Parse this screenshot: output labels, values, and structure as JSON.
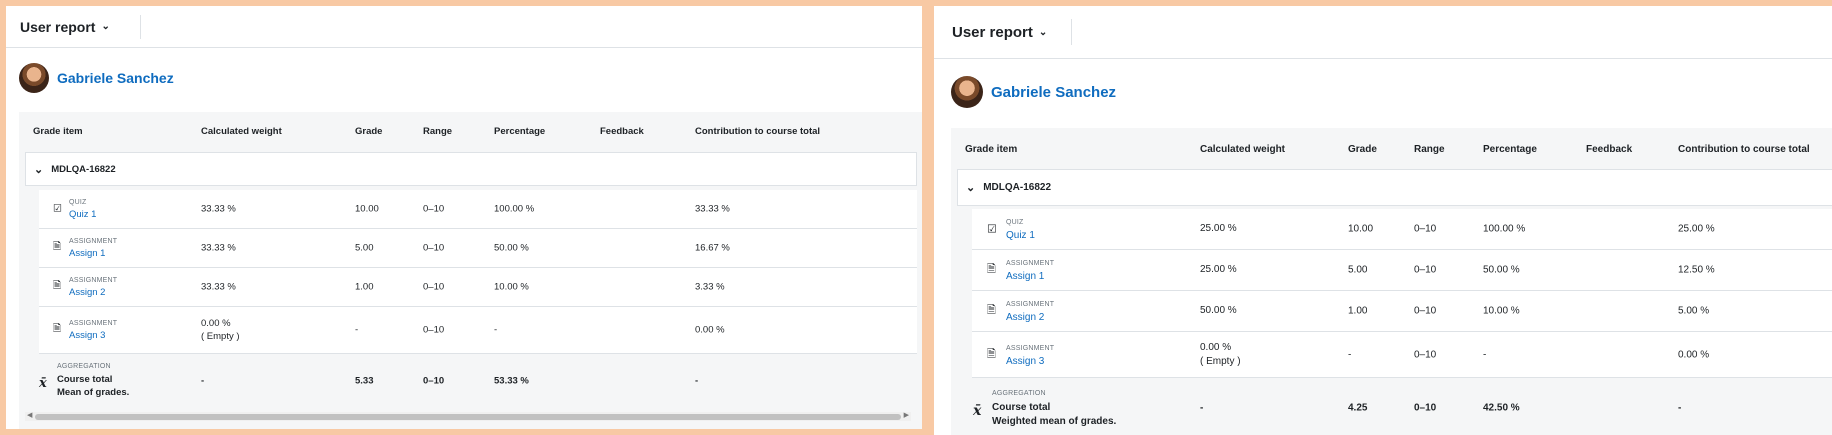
{
  "colors": {
    "background": "#f8c9a4",
    "link": "#0f6cbf",
    "panel": "#ffffff",
    "table_bg": "#f5f6f7"
  },
  "left": {
    "report_selector": "User report",
    "user_name": "Gabriele Sanchez",
    "columns": [
      "Grade item",
      "Calculated weight",
      "Grade",
      "Range",
      "Percentage",
      "Feedback",
      "Contribution to course total"
    ],
    "category": "MDLQA-16822",
    "items": [
      {
        "type": "QUIZ",
        "name": "Quiz 1",
        "icon": "quiz-icon",
        "weight": "33.33 %",
        "weight_note": "",
        "grade": "10.00",
        "range": "0–10",
        "percentage": "100.00 %",
        "feedback": "",
        "contribution": "33.33 %"
      },
      {
        "type": "ASSIGNMENT",
        "name": "Assign 1",
        "icon": "assignment-icon",
        "weight": "33.33 %",
        "weight_note": "",
        "grade": "5.00",
        "range": "0–10",
        "percentage": "50.00 %",
        "feedback": "",
        "contribution": "16.67 %"
      },
      {
        "type": "ASSIGNMENT",
        "name": "Assign 2",
        "icon": "assignment-icon",
        "weight": "33.33 %",
        "weight_note": "",
        "grade": "1.00",
        "range": "0–10",
        "percentage": "10.00 %",
        "feedback": "",
        "contribution": "3.33 %"
      },
      {
        "type": "ASSIGNMENT",
        "name": "Assign 3",
        "icon": "assignment-icon",
        "weight": "0.00 %",
        "weight_note": "( Empty )",
        "grade": "-",
        "range": "0–10",
        "percentage": "-",
        "feedback": "",
        "contribution": "0.00 %"
      }
    ],
    "total": {
      "type": "AGGREGATION",
      "name": "Course total",
      "method": "Mean of grades.",
      "icon": "sigma-x-icon",
      "weight": "-",
      "grade": "5.33",
      "range": "0–10",
      "percentage": "53.33 %",
      "contribution": "-"
    }
  },
  "right": {
    "report_selector": "User report",
    "user_name": "Gabriele Sanchez",
    "columns": [
      "Grade item",
      "Calculated weight",
      "Grade",
      "Range",
      "Percentage",
      "Feedback",
      "Contribution to course total"
    ],
    "category": "MDLQA-16822",
    "items": [
      {
        "type": "QUIZ",
        "name": "Quiz 1",
        "icon": "quiz-icon",
        "weight": "25.00 %",
        "weight_note": "",
        "grade": "10.00",
        "range": "0–10",
        "percentage": "100.00 %",
        "feedback": "",
        "contribution": "25.00 %"
      },
      {
        "type": "ASSIGNMENT",
        "name": "Assign 1",
        "icon": "assignment-icon",
        "weight": "25.00 %",
        "weight_note": "",
        "grade": "5.00",
        "range": "0–10",
        "percentage": "50.00 %",
        "feedback": "",
        "contribution": "12.50 %"
      },
      {
        "type": "ASSIGNMENT",
        "name": "Assign 2",
        "icon": "assignment-icon",
        "weight": "50.00 %",
        "weight_note": "",
        "grade": "1.00",
        "range": "0–10",
        "percentage": "10.00 %",
        "feedback": "",
        "contribution": "5.00 %"
      },
      {
        "type": "ASSIGNMENT",
        "name": "Assign 3",
        "icon": "assignment-icon",
        "weight": "0.00 %",
        "weight_note": "( Empty )",
        "grade": "-",
        "range": "0–10",
        "percentage": "-",
        "feedback": "",
        "contribution": "0.00 %"
      }
    ],
    "total": {
      "type": "AGGREGATION",
      "name": "Course total",
      "method": "Weighted mean of grades.",
      "icon": "sigma-x-icon",
      "weight": "-",
      "grade": "4.25",
      "range": "0–10",
      "percentage": "42.50 %",
      "contribution": "-"
    }
  }
}
